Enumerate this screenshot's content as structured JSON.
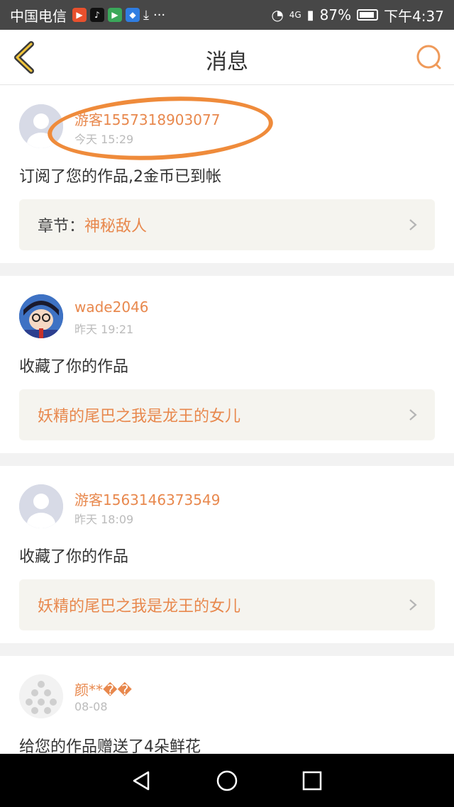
{
  "status_bar": {
    "carrier": "中国电信",
    "more": "···",
    "network": "4G",
    "battery": "87%",
    "time": "下午4:37"
  },
  "header": {
    "title": "消息"
  },
  "messages": [
    {
      "username": "游客1557318903077",
      "time": "今天 15:29",
      "action": "订阅了您的作品,2金币已到帐",
      "work_prefix": "章节：",
      "work_title": "神秘敌人"
    },
    {
      "username": "wade2046",
      "time": "昨天 19:21",
      "action": "收藏了你的作品",
      "work_prefix": "",
      "work_title": "妖精的尾巴之我是龙王的女儿"
    },
    {
      "username": "游客1563146373549",
      "time": "昨天 18:09",
      "action": "收藏了你的作品",
      "work_prefix": "",
      "work_title": "妖精的尾巴之我是龙王的女儿"
    },
    {
      "username": "颜**��",
      "time": "08-08",
      "action": "给您的作品赠送了4朵鲜花"
    }
  ],
  "colors": {
    "accent": "#e8884d",
    "status_bar": "#474747",
    "nav_bar": "#000000"
  }
}
